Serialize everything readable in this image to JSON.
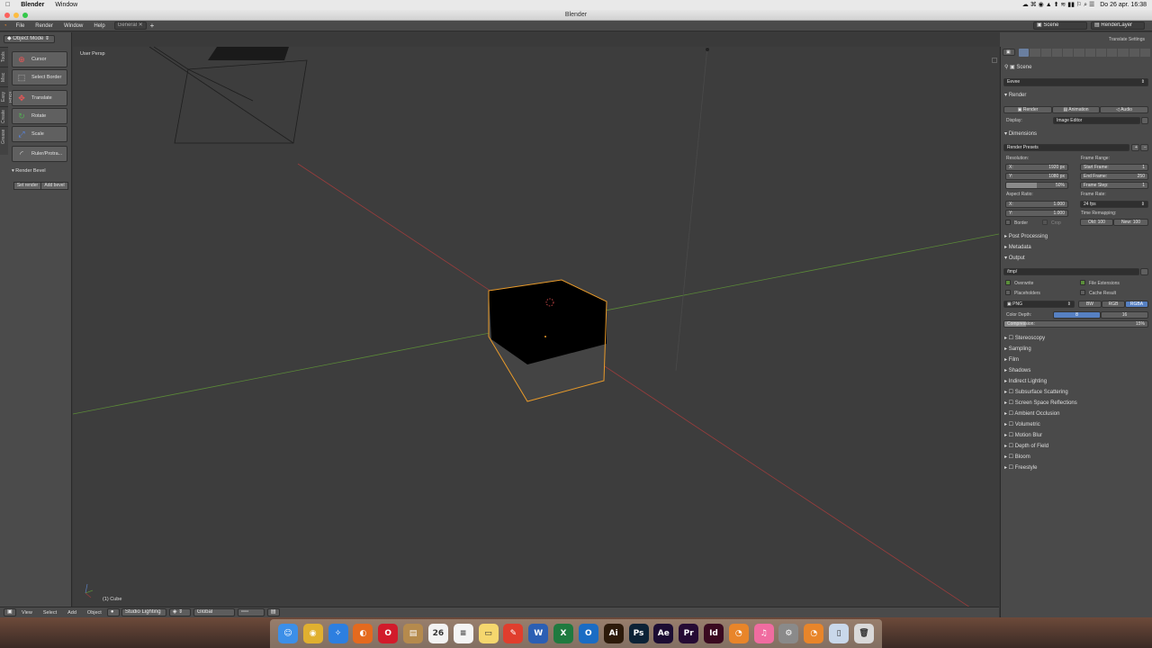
{
  "macos_menubar": {
    "app_name": "Blender",
    "menu": [
      "Window"
    ],
    "clock": "Do 26 apr.  16:38"
  },
  "window": {
    "title": "Blender"
  },
  "info_header": {
    "menus": [
      "File",
      "Render",
      "Window",
      "Help"
    ],
    "workspace": "General",
    "scene": "Scene",
    "render_layer": "RenderLayer"
  },
  "tool_shelf": {
    "tabs": [
      "Tools",
      "Misc",
      "Easy HDRI",
      "Create",
      "Grease"
    ],
    "mode": "Object Mode",
    "tools": [
      "Cursor",
      "Select Border",
      "Translate",
      "Rotate",
      "Scale",
      "Ruler/Protra..."
    ],
    "panel": "Render Bevel",
    "buttons": [
      "Set render",
      "Add bevel"
    ]
  },
  "viewport": {
    "view_name": "User Persp",
    "object_info": "(1) Cube"
  },
  "bottom_header": {
    "menus": [
      "View",
      "Select",
      "Add",
      "Object"
    ],
    "shading": "Studio Lighting",
    "orientation": "Global"
  },
  "properties": {
    "top_label": "Translate Settings",
    "breadcrumb": "Scene",
    "engine": "Eevee",
    "render": {
      "title": "Render",
      "buttons": [
        "Render",
        "Animation",
        "Audio"
      ],
      "display_label": "Display:",
      "display_value": "Image Editor"
    },
    "dimensions": {
      "title": "Dimensions",
      "presets": "Render Presets",
      "resolution_label": "Resolution:",
      "res_x": "X:",
      "res_x_val": "1920 px",
      "res_y": "Y:",
      "res_y_val": "1080 px",
      "res_pct": "50%",
      "frame_range_label": "Frame Range:",
      "start": "Start Frame:",
      "start_val": "1",
      "end": "End Frame:",
      "end_val": "250",
      "step": "Frame Step:",
      "step_val": "1",
      "aspect_label": "Aspect Ratio:",
      "asp_x": "X:",
      "asp_x_val": "1.000",
      "asp_y": "Y:",
      "asp_y_val": "1.000",
      "frame_rate_label": "Frame Rate:",
      "fps": "24 fps",
      "time_remap_label": "Time Remapping:",
      "old": "Old: 100",
      "new": "New: 100",
      "border": "Border",
      "crop": "Crop"
    },
    "collapsed_top": [
      "Post Processing",
      "Metadata"
    ],
    "output": {
      "title": "Output",
      "path": "/tmp/",
      "overwrite": "Overwrite",
      "file_ext": "File Extensions",
      "placeholders": "Placeholders",
      "cache": "Cache Result",
      "format": "PNG",
      "color_modes": [
        "BW",
        "RGB",
        "RGBA"
      ],
      "depth_label": "Color Depth:",
      "depth_8": "8",
      "depth_16": "16",
      "compression_label": "Compression:",
      "compression_val": "15%"
    },
    "collapsed_bottom": [
      "Stereoscopy",
      "Sampling",
      "Film",
      "Shadows",
      "Indirect Lighting",
      "Subsurface Scattering",
      "Screen Space Reflections",
      "Ambient Occlusion",
      "Volumetric",
      "Motion Blur",
      "Depth of Field",
      "Bloom",
      "Freestyle"
    ]
  },
  "dock": {
    "apps": [
      {
        "icon": "finder-icon",
        "color": "#3c8fe8",
        "glyph": "☺"
      },
      {
        "icon": "chrome-icon",
        "color": "#e0b030",
        "glyph": "◉"
      },
      {
        "icon": "safari-icon",
        "color": "#2d7fe0",
        "glyph": "✧"
      },
      {
        "icon": "firefox-icon",
        "color": "#e46a1e",
        "glyph": "◐"
      },
      {
        "icon": "opera-icon",
        "color": "#d21b2b",
        "glyph": "O"
      },
      {
        "icon": "contacts-icon",
        "color": "#b58a4d",
        "glyph": "▤"
      },
      {
        "icon": "calendar-icon",
        "color": "#f2f2f2",
        "glyph": "26"
      },
      {
        "icon": "reminders-icon",
        "color": "#f4f4f4",
        "glyph": "≡"
      },
      {
        "icon": "notes-icon",
        "color": "#f5d76e",
        "glyph": "▭"
      },
      {
        "icon": "pdf-icon",
        "color": "#e03e2d",
        "glyph": "✎"
      },
      {
        "icon": "word-icon",
        "color": "#2b5fb4",
        "glyph": "W"
      },
      {
        "icon": "excel-icon",
        "color": "#1f7a3f",
        "glyph": "X"
      },
      {
        "icon": "outlook-icon",
        "color": "#1a6cc4",
        "glyph": "O"
      },
      {
        "icon": "illustrator-icon",
        "color": "#2c1a0a",
        "glyph": "Ai"
      },
      {
        "icon": "photoshop-icon",
        "color": "#0b2236",
        "glyph": "Ps"
      },
      {
        "icon": "aftereffects-icon",
        "color": "#1c0d33",
        "glyph": "Ae"
      },
      {
        "icon": "premiere-icon",
        "color": "#250b34",
        "glyph": "Pr"
      },
      {
        "icon": "indesign-icon",
        "color": "#3a0a20",
        "glyph": "Id"
      },
      {
        "icon": "blender-icon",
        "color": "#e8852a",
        "glyph": "◔"
      },
      {
        "icon": "itunes-icon",
        "color": "#f06ca0",
        "glyph": "♫"
      },
      {
        "icon": "preferences-icon",
        "color": "#8a8a8a",
        "glyph": "⚙"
      },
      {
        "icon": "blender2-icon",
        "color": "#e8852a",
        "glyph": "◔"
      },
      {
        "icon": "documents-icon",
        "color": "#c9d8ea",
        "glyph": "▯"
      },
      {
        "icon": "trash-icon",
        "color": "#d9d9d9",
        "glyph": "🗑"
      }
    ]
  }
}
